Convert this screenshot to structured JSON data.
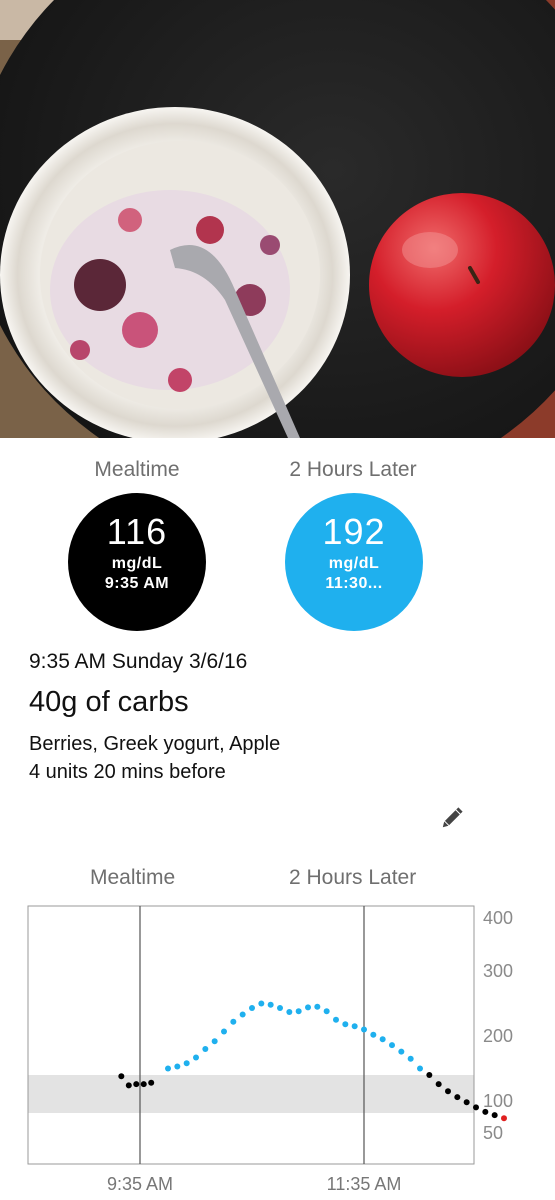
{
  "readings": {
    "mealtime": {
      "label": "Mealtime",
      "value": "116",
      "unit": "mg/dL",
      "time": "9:35 AM",
      "color": "#000000"
    },
    "later": {
      "label": "2 Hours Later",
      "value": "192",
      "unit": "mg/dL",
      "time": "11:30...",
      "color": "#1fb0ee"
    }
  },
  "meal": {
    "datetime": "9:35 AM Sunday 3/6/16",
    "carbs": "40g of carbs",
    "foods": "Berries, Greek yogurt, Apple",
    "insulin": "4 units 20 mins before"
  },
  "edit_icon": "pencil-icon",
  "chart_data": {
    "type": "scatter",
    "markers": [
      "Mealtime",
      "2 Hours Later"
    ],
    "x_tick_labels": [
      "9:35 AM",
      "11:35 AM"
    ],
    "y_tick_labels": [
      "400",
      "300",
      "200",
      "100",
      "50"
    ],
    "target_range": [
      80,
      140
    ],
    "colors": {
      "normal": "#000000",
      "high": "#1fb0ee",
      "low": "#e02020",
      "range_band": "#e3e3e3"
    },
    "points": [
      {
        "t": -10,
        "v": 138,
        "c": "normal"
      },
      {
        "t": -6,
        "v": 124,
        "c": "normal"
      },
      {
        "t": -2,
        "v": 126,
        "c": "normal"
      },
      {
        "t": 2,
        "v": 126,
        "c": "normal"
      },
      {
        "t": 6,
        "v": 128,
        "c": "normal"
      },
      {
        "t": 15,
        "v": 150,
        "c": "high"
      },
      {
        "t": 20,
        "v": 153,
        "c": "high"
      },
      {
        "t": 25,
        "v": 158,
        "c": "high"
      },
      {
        "t": 30,
        "v": 167,
        "c": "high"
      },
      {
        "t": 35,
        "v": 180,
        "c": "high"
      },
      {
        "t": 40,
        "v": 192,
        "c": "high"
      },
      {
        "t": 45,
        "v": 207,
        "c": "high"
      },
      {
        "t": 50,
        "v": 222,
        "c": "high"
      },
      {
        "t": 55,
        "v": 233,
        "c": "high"
      },
      {
        "t": 60,
        "v": 243,
        "c": "high"
      },
      {
        "t": 65,
        "v": 250,
        "c": "high"
      },
      {
        "t": 70,
        "v": 248,
        "c": "high"
      },
      {
        "t": 75,
        "v": 243,
        "c": "high"
      },
      {
        "t": 80,
        "v": 237,
        "c": "high"
      },
      {
        "t": 85,
        "v": 238,
        "c": "high"
      },
      {
        "t": 90,
        "v": 244,
        "c": "high"
      },
      {
        "t": 95,
        "v": 245,
        "c": "high"
      },
      {
        "t": 100,
        "v": 238,
        "c": "high"
      },
      {
        "t": 105,
        "v": 225,
        "c": "high"
      },
      {
        "t": 110,
        "v": 218,
        "c": "high"
      },
      {
        "t": 115,
        "v": 215,
        "c": "high"
      },
      {
        "t": 120,
        "v": 210,
        "c": "high"
      },
      {
        "t": 125,
        "v": 202,
        "c": "high"
      },
      {
        "t": 130,
        "v": 195,
        "c": "high"
      },
      {
        "t": 135,
        "v": 186,
        "c": "high"
      },
      {
        "t": 140,
        "v": 176,
        "c": "high"
      },
      {
        "t": 145,
        "v": 165,
        "c": "high"
      },
      {
        "t": 150,
        "v": 150,
        "c": "high"
      },
      {
        "t": 155,
        "v": 140,
        "c": "normal"
      },
      {
        "t": 160,
        "v": 126,
        "c": "normal"
      },
      {
        "t": 165,
        "v": 115,
        "c": "normal"
      },
      {
        "t": 170,
        "v": 106,
        "c": "normal"
      },
      {
        "t": 175,
        "v": 98,
        "c": "normal"
      },
      {
        "t": 180,
        "v": 90,
        "c": "normal"
      },
      {
        "t": 185,
        "v": 83,
        "c": "normal"
      },
      {
        "t": 190,
        "v": 78,
        "c": "normal"
      },
      {
        "t": 195,
        "v": 73,
        "c": "low"
      }
    ]
  }
}
